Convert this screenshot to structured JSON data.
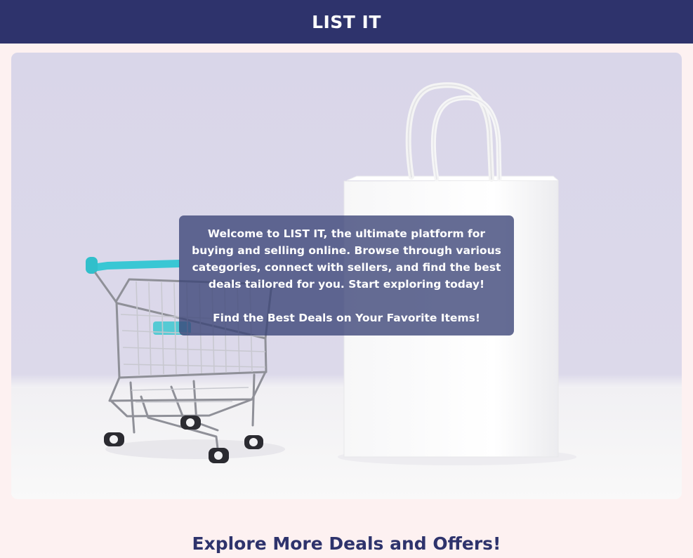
{
  "header": {
    "brand": "LIST IT"
  },
  "hero": {
    "image_icon": "shopping-cart-and-bag-photo",
    "intro": "Welcome to LIST IT, the ultimate platform for buying and selling online. Browse through various categories, connect with sellers, and find the best deals tailored for you. Start exploring today!",
    "tagline": "Find the Best Deals on Your Favorite Items!"
  },
  "section": {
    "title": "Explore More Deals and Offers!"
  },
  "colors": {
    "header_bg": "#2e336c",
    "page_bg": "#fdf1f1",
    "overlay_bg": "rgba(58,66,118,0.78)",
    "title_text": "#2e336c",
    "cart_handle": "#39c7d4"
  }
}
